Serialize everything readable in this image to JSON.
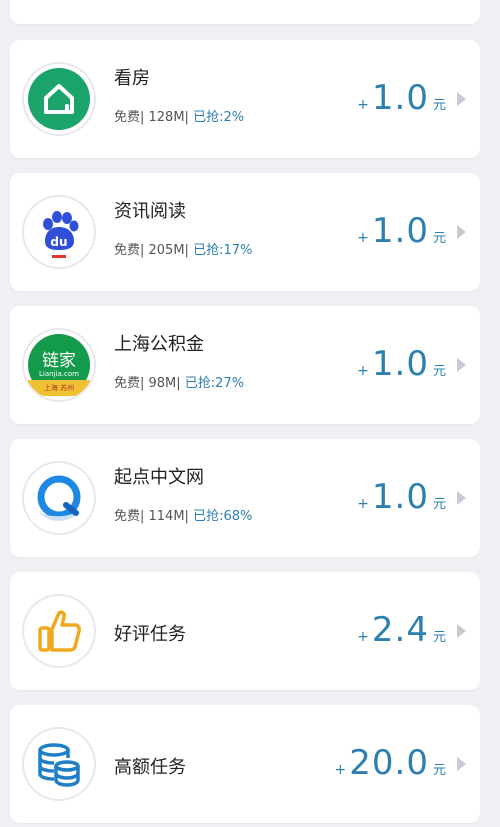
{
  "tasks": [
    {
      "title": "看房",
      "meta_prefix": "免费| 128M|",
      "claimed": "已抢:2%",
      "plus": "+",
      "amount": "1.0",
      "unit": "元",
      "icon": "home-icon"
    },
    {
      "title": "资讯阅读",
      "meta_prefix": "免费| 205M|",
      "claimed": "已抢:17%",
      "plus": "+",
      "amount": "1.0",
      "unit": "元",
      "icon": "baidu-paw-icon"
    },
    {
      "title": "上海公积金",
      "meta_prefix": "免费| 98M|",
      "claimed": "已抢:27%",
      "plus": "+",
      "amount": "1.0",
      "unit": "元",
      "icon": "lianjia-logo-icon",
      "icon_text_main": "链家",
      "icon_text_sub": "Lianjia.com",
      "icon_text_strip": "上海 苏州"
    },
    {
      "title": "起点中文网",
      "meta_prefix": "免费| 114M|",
      "claimed": "已抢:68%",
      "plus": "+",
      "amount": "1.0",
      "unit": "元",
      "icon": "qq-browser-icon"
    },
    {
      "title": "好评任务",
      "plus": "+",
      "amount": "2.4",
      "unit": "元",
      "icon": "thumbs-up-icon"
    },
    {
      "title": "高额任务",
      "plus": "+",
      "amount": "20.0",
      "unit": "元",
      "icon": "coin-stack-icon"
    }
  ],
  "colors": {
    "accent": "#2d7fb0",
    "background": "#eef0f4",
    "card": "#ffffff"
  }
}
